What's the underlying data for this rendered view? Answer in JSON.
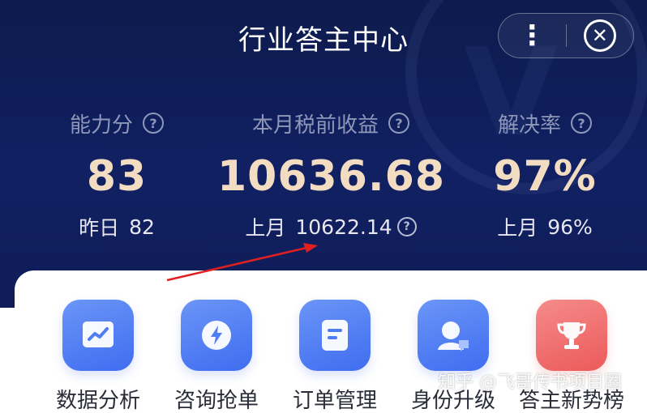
{
  "header": {
    "title": "行业答主中心",
    "more_glyph": "⋮",
    "close_glyph": "✕"
  },
  "stats": [
    {
      "label": "能力分",
      "help": "?",
      "value": "83",
      "sub_label": "昨日",
      "sub_value": "82"
    },
    {
      "label": "本月税前收益",
      "help": "?",
      "value": "10636.68",
      "sub_label": "上月",
      "sub_value": "10622.14",
      "sub_help": "?"
    },
    {
      "label": "解决率",
      "help": "?",
      "value": "97%",
      "sub_label": "上月",
      "sub_value": "96%"
    }
  ],
  "menu": [
    {
      "label": "数据分析",
      "icon": "chart-icon",
      "color": "#4f7ef3"
    },
    {
      "label": "咨询抢单",
      "icon": "lightning-icon",
      "color": "#4f7ef3"
    },
    {
      "label": "订单管理",
      "icon": "document-icon",
      "color": "#4f7ef3"
    },
    {
      "label": "身份升级",
      "icon": "user-chat-icon",
      "color": "#4f7ef3"
    },
    {
      "label": "答主新势榜",
      "icon": "trophy-icon",
      "color": "#f06b6b"
    }
  ],
  "watermark": "知乎 @飞哥传书项目圈",
  "colors": {
    "hero_bg": "#0f1d57",
    "value_gold": "#f2dcc2",
    "label_gray": "#8e97b8",
    "annotation_arrow": "#e02020"
  }
}
